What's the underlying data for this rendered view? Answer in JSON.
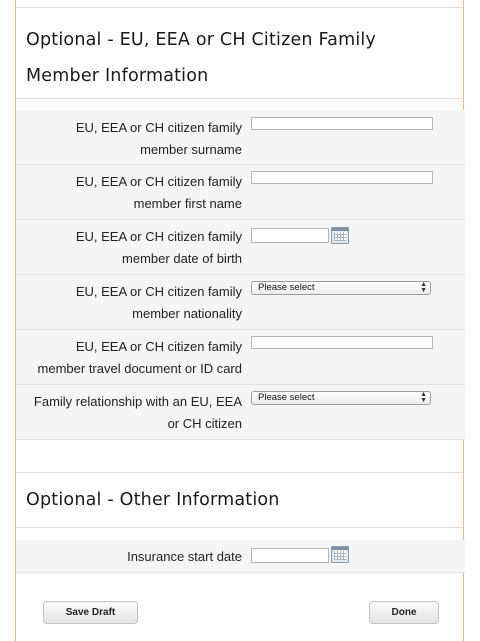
{
  "section1": {
    "title": "Optional - EU, EEA or CH Citizen Family Member Information",
    "fields": [
      {
        "label_line1": "EU, EEA or CH citizen family",
        "label_line2": "member surname",
        "type": "text",
        "value": ""
      },
      {
        "label_line1": "EU, EEA or CH citizen family",
        "label_line2": "member first name",
        "type": "text",
        "value": ""
      },
      {
        "label_line1": "EU, EEA or CH citizen family",
        "label_line2": "member date of birth",
        "type": "date",
        "value": ""
      },
      {
        "label_line1": "EU, EEA or CH citizen family",
        "label_line2": "member nationality",
        "type": "select",
        "value": "Please select"
      },
      {
        "label_line1": "EU, EEA or CH citizen family",
        "label_line2": "member travel document or ID card",
        "type": "text",
        "value": ""
      },
      {
        "label_line1": "Family relationship with an EU, EEA",
        "label_line2": "or CH citizen",
        "type": "select",
        "value": "Please select"
      }
    ]
  },
  "section2": {
    "title": "Optional - Other Information",
    "fields": [
      {
        "label": "Insurance start date",
        "type": "date",
        "value": ""
      }
    ]
  },
  "buttons": {
    "save_draft": "Save Draft",
    "done": "Done"
  },
  "icons": {
    "calendar": "calendar-icon",
    "select_arrows": "up-down-arrows-icon"
  },
  "colors": {
    "frame_border": "#f0b87a",
    "row_background": "#f5f5f5"
  }
}
